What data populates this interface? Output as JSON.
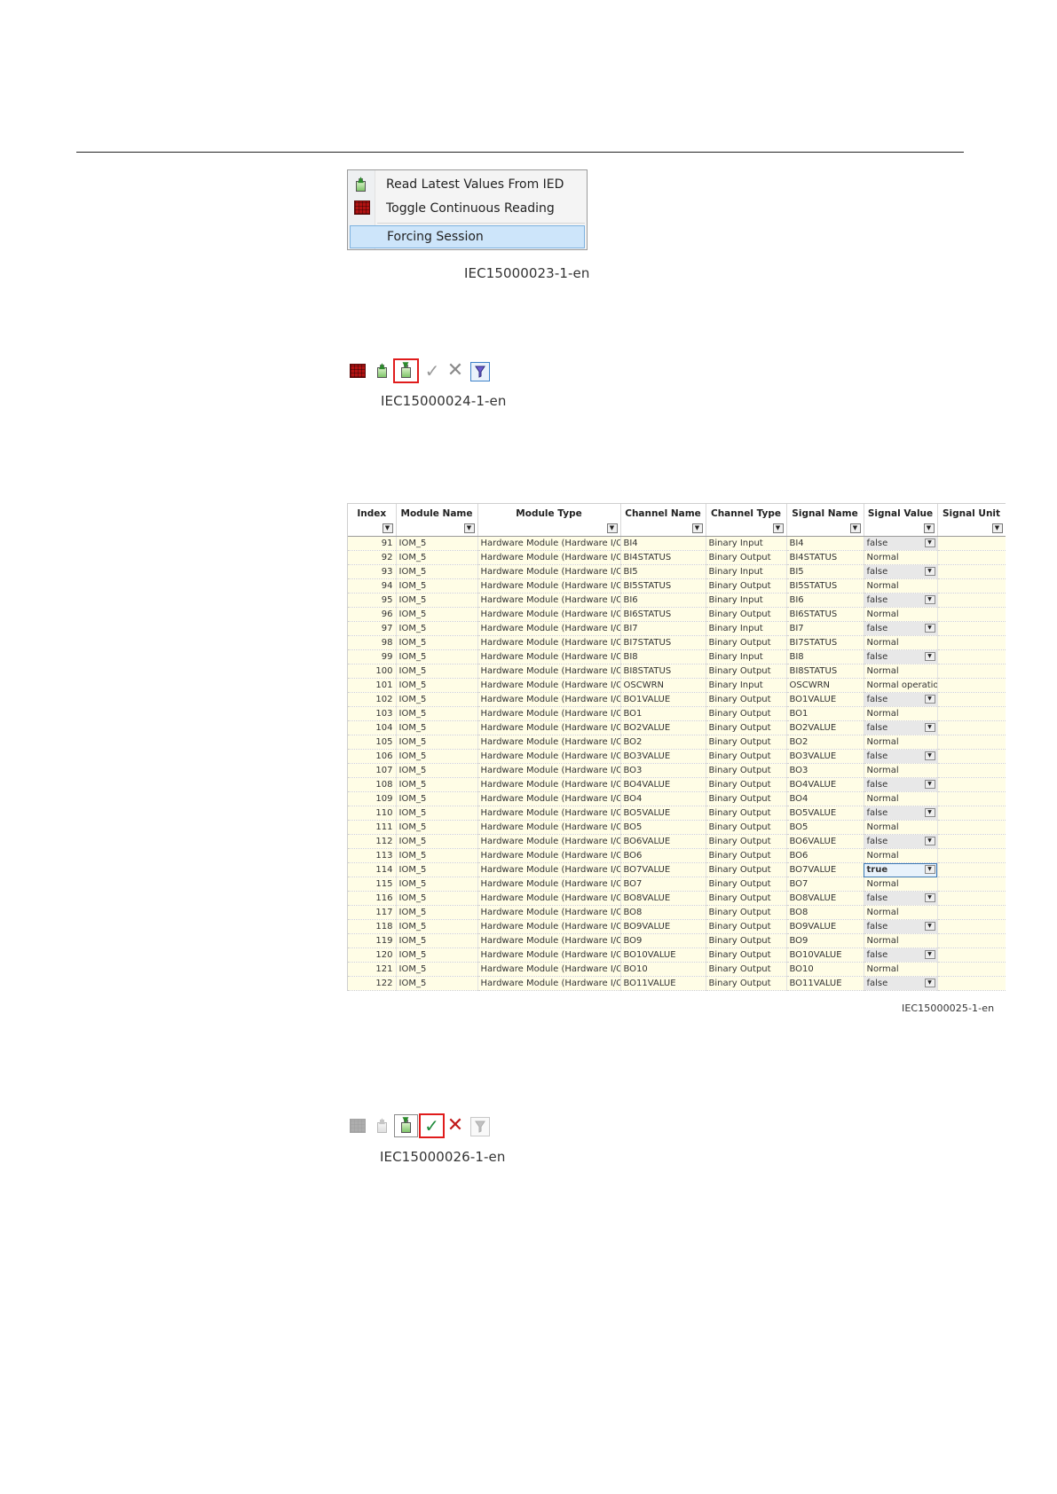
{
  "figure1": {
    "menu_items": [
      {
        "label": "Read Latest Values From IED",
        "icon": "read-values-icon"
      },
      {
        "label": "Toggle Continuous Reading",
        "icon": "continuous-reading-icon"
      },
      {
        "label": "Forcing Session",
        "icon": ""
      }
    ],
    "caption": "IEC15000023-1-en"
  },
  "figure2": {
    "caption": "IEC15000024-1-en",
    "highlighted_button": "start-forcing"
  },
  "figure3": {
    "columns": [
      "Index",
      "Module Name",
      "Module Type",
      "Channel Name",
      "Channel Type",
      "Signal Name",
      "Signal Value",
      "Signal Unit"
    ],
    "rows": [
      [
        "91",
        "IOM_5",
        "Hardware Module (Hardware I/O)",
        "BI4",
        "Binary Input",
        "BI4",
        "false",
        ""
      ],
      [
        "92",
        "IOM_5",
        "Hardware Module (Hardware I/O)",
        "BI4STATUS",
        "Binary Output",
        "BI4STATUS",
        "Normal",
        ""
      ],
      [
        "93",
        "IOM_5",
        "Hardware Module (Hardware I/O)",
        "BI5",
        "Binary Input",
        "BI5",
        "false",
        ""
      ],
      [
        "94",
        "IOM_5",
        "Hardware Module (Hardware I/O)",
        "BI5STATUS",
        "Binary Output",
        "BI5STATUS",
        "Normal",
        ""
      ],
      [
        "95",
        "IOM_5",
        "Hardware Module (Hardware I/O)",
        "BI6",
        "Binary Input",
        "BI6",
        "false",
        ""
      ],
      [
        "96",
        "IOM_5",
        "Hardware Module (Hardware I/O)",
        "BI6STATUS",
        "Binary Output",
        "BI6STATUS",
        "Normal",
        ""
      ],
      [
        "97",
        "IOM_5",
        "Hardware Module (Hardware I/O)",
        "BI7",
        "Binary Input",
        "BI7",
        "false",
        ""
      ],
      [
        "98",
        "IOM_5",
        "Hardware Module (Hardware I/O)",
        "BI7STATUS",
        "Binary Output",
        "BI7STATUS",
        "Normal",
        ""
      ],
      [
        "99",
        "IOM_5",
        "Hardware Module (Hardware I/O)",
        "BI8",
        "Binary Input",
        "BI8",
        "false",
        ""
      ],
      [
        "100",
        "IOM_5",
        "Hardware Module (Hardware I/O)",
        "BI8STATUS",
        "Binary Output",
        "BI8STATUS",
        "Normal",
        ""
      ],
      [
        "101",
        "IOM_5",
        "Hardware Module (Hardware I/O)",
        "OSCWRN",
        "Binary Input",
        "OSCWRN",
        "Normal operation",
        ""
      ],
      [
        "102",
        "IOM_5",
        "Hardware Module (Hardware I/O)",
        "BO1VALUE",
        "Binary Output",
        "BO1VALUE",
        "false",
        ""
      ],
      [
        "103",
        "IOM_5",
        "Hardware Module (Hardware I/O)",
        "BO1",
        "Binary Output",
        "BO1",
        "Normal",
        ""
      ],
      [
        "104",
        "IOM_5",
        "Hardware Module (Hardware I/O)",
        "BO2VALUE",
        "Binary Output",
        "BO2VALUE",
        "false",
        ""
      ],
      [
        "105",
        "IOM_5",
        "Hardware Module (Hardware I/O)",
        "BO2",
        "Binary Output",
        "BO2",
        "Normal",
        ""
      ],
      [
        "106",
        "IOM_5",
        "Hardware Module (Hardware I/O)",
        "BO3VALUE",
        "Binary Output",
        "BO3VALUE",
        "false",
        ""
      ],
      [
        "107",
        "IOM_5",
        "Hardware Module (Hardware I/O)",
        "BO3",
        "Binary Output",
        "BO3",
        "Normal",
        ""
      ],
      [
        "108",
        "IOM_5",
        "Hardware Module (Hardware I/O)",
        "BO4VALUE",
        "Binary Output",
        "BO4VALUE",
        "false",
        ""
      ],
      [
        "109",
        "IOM_5",
        "Hardware Module (Hardware I/O)",
        "BO4",
        "Binary Output",
        "BO4",
        "Normal",
        ""
      ],
      [
        "110",
        "IOM_5",
        "Hardware Module (Hardware I/O)",
        "BO5VALUE",
        "Binary Output",
        "BO5VALUE",
        "false",
        ""
      ],
      [
        "111",
        "IOM_5",
        "Hardware Module (Hardware I/O)",
        "BO5",
        "Binary Output",
        "BO5",
        "Normal",
        ""
      ],
      [
        "112",
        "IOM_5",
        "Hardware Module (Hardware I/O)",
        "BO6VALUE",
        "Binary Output",
        "BO6VALUE",
        "false",
        ""
      ],
      [
        "113",
        "IOM_5",
        "Hardware Module (Hardware I/O)",
        "BO6",
        "Binary Output",
        "BO6",
        "Normal",
        ""
      ],
      [
        "114",
        "IOM_5",
        "Hardware Module (Hardware I/O)",
        "BO7VALUE",
        "Binary Output",
        "BO7VALUE",
        "true",
        ""
      ],
      [
        "115",
        "IOM_5",
        "Hardware Module (Hardware I/O)",
        "BO7",
        "Binary Output",
        "BO7",
        "Normal",
        ""
      ],
      [
        "116",
        "IOM_5",
        "Hardware Module (Hardware I/O)",
        "BO8VALUE",
        "Binary Output",
        "BO8VALUE",
        "false",
        ""
      ],
      [
        "117",
        "IOM_5",
        "Hardware Module (Hardware I/O)",
        "BO8",
        "Binary Output",
        "BO8",
        "Normal",
        ""
      ],
      [
        "118",
        "IOM_5",
        "Hardware Module (Hardware I/O)",
        "BO9VALUE",
        "Binary Output",
        "BO9VALUE",
        "false",
        ""
      ],
      [
        "119",
        "IOM_5",
        "Hardware Module (Hardware I/O)",
        "BO9",
        "Binary Output",
        "BO9",
        "Normal",
        ""
      ],
      [
        "120",
        "IOM_5",
        "Hardware Module (Hardware I/O)",
        "BO10VALUE",
        "Binary Output",
        "BO10VALUE",
        "false",
        ""
      ],
      [
        "121",
        "IOM_5",
        "Hardware Module (Hardware I/O)",
        "BO10",
        "Binary Output",
        "BO10",
        "Normal",
        ""
      ],
      [
        "122",
        "IOM_5",
        "Hardware Module (Hardware I/O)",
        "BO11VALUE",
        "Binary Output",
        "BO11VALUE",
        "false",
        ""
      ]
    ],
    "active_value_row": "114",
    "caption": "IEC15000025-1-en"
  },
  "figure4": {
    "caption": "IEC15000026-1-en",
    "highlighted_button": "commit-values"
  },
  "colors": {
    "highlight_red": "#e01c1c",
    "menu_selection": "#cde5fa",
    "row_background": "#fffde6",
    "editable_cell": "#e8e8e8"
  }
}
